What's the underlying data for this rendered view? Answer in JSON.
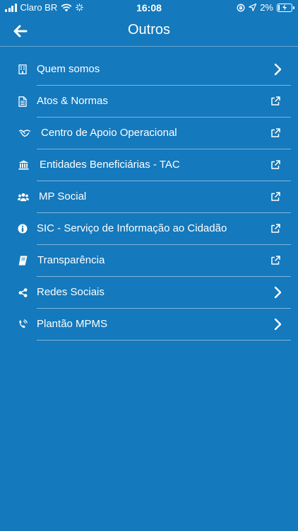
{
  "status_bar": {
    "carrier": "Claro BR",
    "time": "16:08",
    "battery": "2%"
  },
  "header": {
    "title": "Outros"
  },
  "menu": {
    "items": [
      {
        "label": "Quem somos",
        "icon": "building-icon",
        "action": "chevron"
      },
      {
        "label": "Atos & Normas",
        "icon": "document-icon",
        "action": "external"
      },
      {
        "label": "Centro de Apoio Operacional",
        "icon": "handshake-icon",
        "action": "external"
      },
      {
        "label": "Entidades Beneficiárias - TAC",
        "icon": "bank-icon",
        "action": "external"
      },
      {
        "label": "MP Social",
        "icon": "users-icon",
        "action": "external"
      },
      {
        "label": "SIC - Serviço de Informação ao Cidadão",
        "icon": "info-icon",
        "action": "external"
      },
      {
        "label": "Transparência",
        "icon": "book-icon",
        "action": "external"
      },
      {
        "label": "Redes Sociais",
        "icon": "share-icon",
        "action": "chevron"
      },
      {
        "label": "Plantão MPMS",
        "icon": "phone-volume-icon",
        "action": "chevron"
      }
    ]
  },
  "colors": {
    "background": "#1479bd",
    "text": "#ffffff"
  }
}
